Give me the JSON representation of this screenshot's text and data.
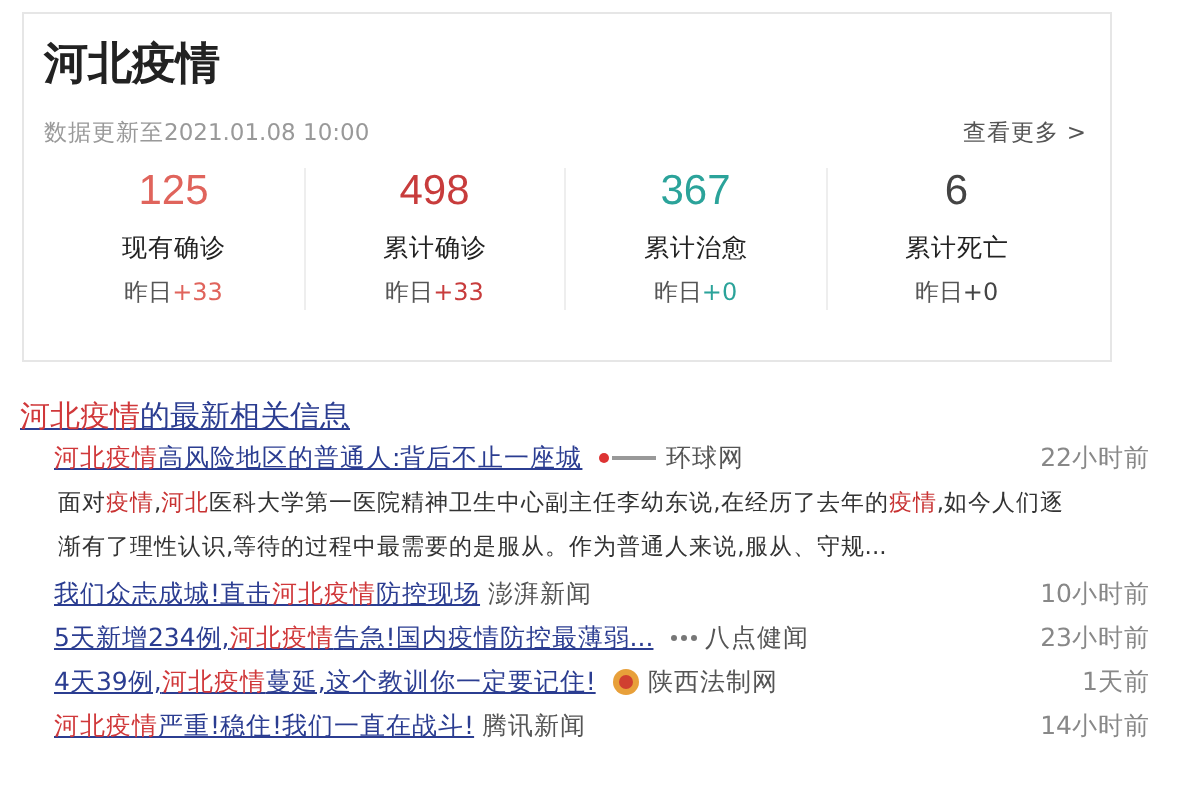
{
  "card": {
    "title": "河北疫情",
    "updated": "数据更新至2021.01.08 10:00",
    "more_link": "查看更多 >",
    "stats": [
      {
        "value": "125",
        "label": "现有确诊",
        "delta_prefix": "昨日",
        "delta": "+33",
        "color": "#e0645c"
      },
      {
        "value": "498",
        "label": "累计确诊",
        "delta_prefix": "昨日",
        "delta": "+33",
        "color": "#c83c3c"
      },
      {
        "value": "367",
        "label": "累计治愈",
        "delta_prefix": "昨日",
        "delta": "+0",
        "color": "#2ba39a"
      },
      {
        "value": "6",
        "label": "累计死亡",
        "delta_prefix": "昨日",
        "delta": "+0",
        "color": "#444444"
      }
    ]
  },
  "news": {
    "heading": [
      {
        "text": "河北疫情",
        "highlight": true
      },
      {
        "text": "的最新相关信息",
        "highlight": false
      }
    ],
    "items": [
      {
        "title": [
          {
            "text": "河北疫情",
            "highlight": true
          },
          {
            "text": "高风险地区的普通人:背后不止一座城",
            "highlight": false
          }
        ],
        "source": "环球网",
        "kind": "cnr",
        "time": "22小时前",
        "snippet": [
          {
            "text": "面对",
            "highlight": false
          },
          {
            "text": "疫情",
            "highlight": true
          },
          {
            "text": ",",
            "highlight": false
          },
          {
            "text": "河北",
            "highlight": true
          },
          {
            "text": "医科大学第一医院精神卫生中心副主任李幼东说,在经历了去年的",
            "highlight": false
          },
          {
            "text": "疫情",
            "highlight": true
          },
          {
            "text": ",如今人们逐渐有了理性认识,等待的过程中最需要的是服从。作为普通人来说,服从、守规...",
            "highlight": false
          }
        ]
      },
      {
        "title": [
          {
            "text": "我们众志成城!直击",
            "highlight": false
          },
          {
            "text": "河北疫情",
            "highlight": true
          },
          {
            "text": "防控现场",
            "highlight": false
          }
        ],
        "source": "澎湃新闻",
        "kind": "plain",
        "time": "10小时前"
      },
      {
        "title": [
          {
            "text": "5天新增234例,",
            "highlight": false
          },
          {
            "text": "河北疫情",
            "highlight": true
          },
          {
            "text": "告急!国内疫情防控最薄弱...",
            "highlight": false
          }
        ],
        "source": "八点健闻",
        "kind": "dots",
        "time": "23小时前"
      },
      {
        "title": [
          {
            "text": "4天39例,",
            "highlight": false
          },
          {
            "text": "河北疫情",
            "highlight": true
          },
          {
            "text": "蔓延,这个教训你一定要记住!",
            "highlight": false
          }
        ],
        "source": "陕西法制网",
        "kind": "emblem",
        "time": "1天前"
      },
      {
        "title": [
          {
            "text": "河北疫情",
            "highlight": true
          },
          {
            "text": "严重!稳住!我们一直在战斗!",
            "highlight": false
          }
        ],
        "source": "腾讯新闻",
        "kind": "plain",
        "time": "14小时前"
      }
    ]
  }
}
